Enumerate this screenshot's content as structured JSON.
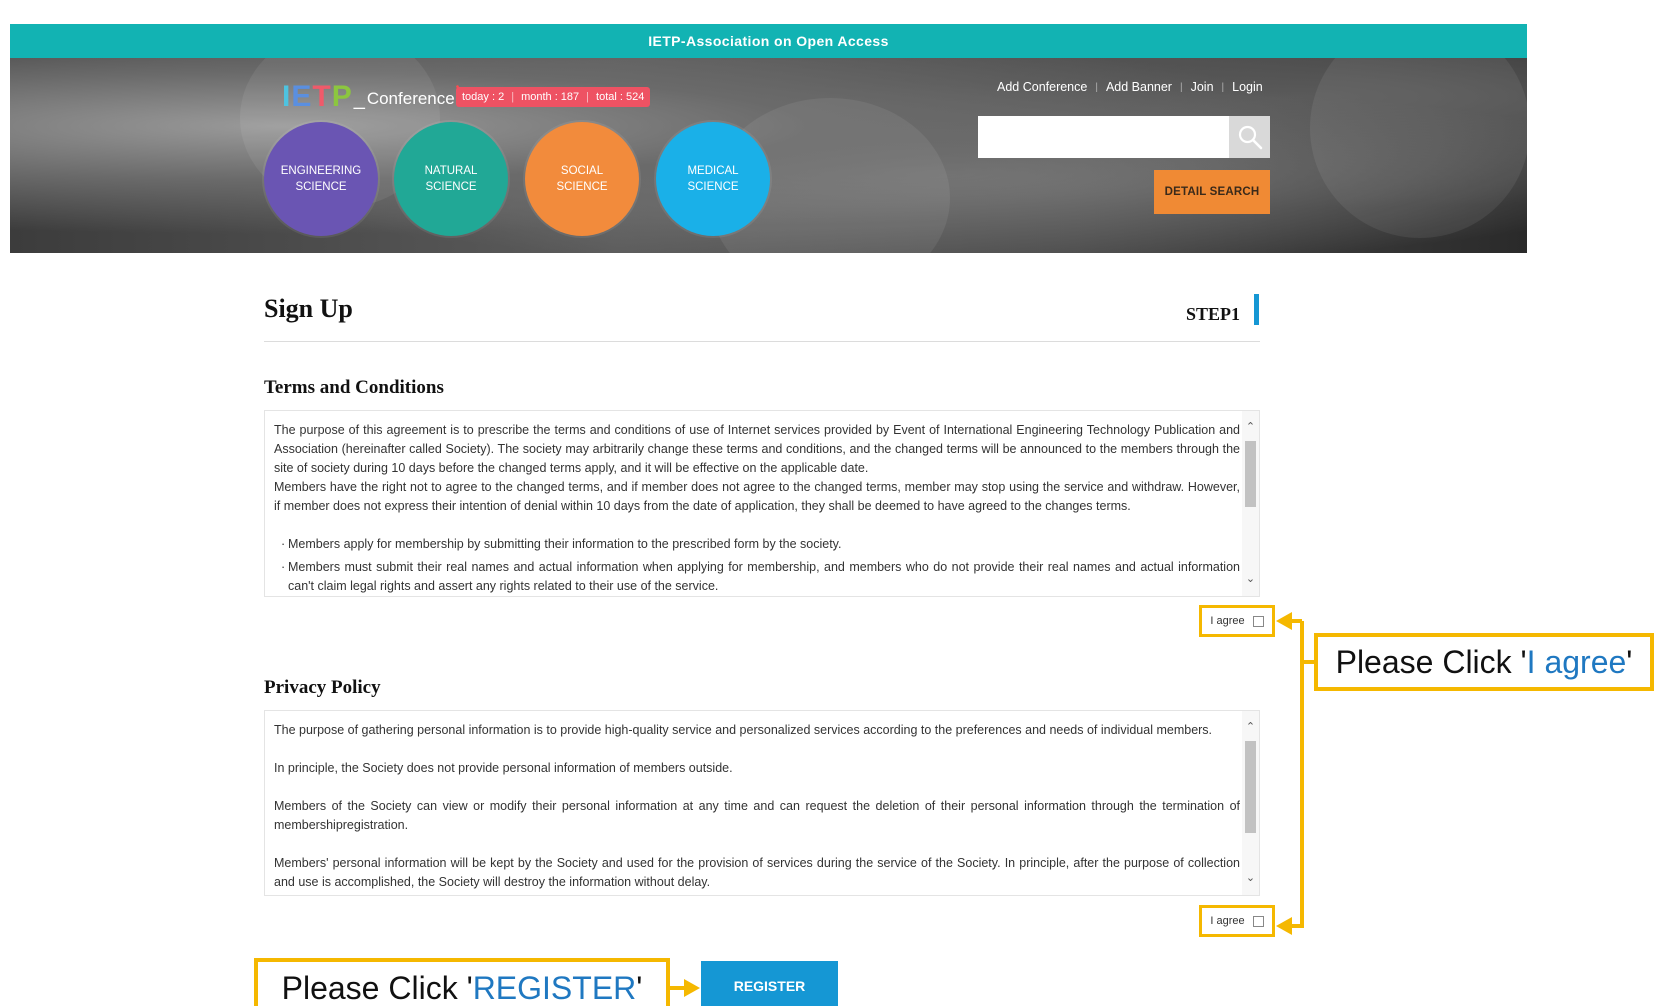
{
  "top_strip": {
    "title": "IETP-Association on Open Access"
  },
  "header": {
    "logo": {
      "letters": [
        "I",
        "E",
        "T",
        "P"
      ],
      "underscore": "_",
      "text": "Conference",
      "dot": "•"
    },
    "stats": {
      "today": "today : 2",
      "month": "month : 187",
      "total": "total : 524"
    },
    "categories": [
      {
        "label": "ENGINEERING\nSCIENCE",
        "color": "#6a55b3"
      },
      {
        "label": "NATURAL\nSCIENCE",
        "color": "#21a896"
      },
      {
        "label": "SOCIAL\nSCIENCE",
        "color": "#f28b3c"
      },
      {
        "label": "MEDICAL\nSCIENCE",
        "color": "#1ab0e8"
      }
    ],
    "links": {
      "add_conference": "Add Conference",
      "add_banner": "Add Banner",
      "join": "Join",
      "login": "Login"
    },
    "search": {
      "placeholder": "",
      "icon": "search-icon"
    },
    "detail_search": "DETAIL SEARCH"
  },
  "page": {
    "title": "Sign Up",
    "step": "STEP1"
  },
  "terms": {
    "title": "Terms and Conditions",
    "para1": "The purpose of this agreement is to prescribe the terms and conditions of use of Internet services provided by Event of International Engineering Technology Publication and Association (hereinafter called Society). The society may arbitrarily change these terms and conditions, and the changed terms will be announced to the members through the site of society during 10 days before the changed terms apply, and it will be effective on the applicable date.",
    "para2": "Members have the right not to agree to the changed terms, and if member does not agree to the changed terms, member may stop using the service and withdraw. However, if member does not express their intention of denial within 10 days from the date of application, they shall be deemed to have agreed to the changes terms.",
    "bullet1": "Members apply for membership by submitting their information to the prescribed form by the society.",
    "bullet2": "Members must submit their real names and actual information when applying for membership, and members who do not provide their real names and actual information can't claim legal rights and assert any rights related to their use of the service.",
    "agree_label": "I agree"
  },
  "privacy": {
    "title": "Privacy Policy",
    "para1": "The purpose of gathering personal information is to provide high-quality service and personalized services according to the preferences and needs of individual members.",
    "para2": "In principle, the Society does not provide personal information of members outside.",
    "para3": "Members of the Society can view or modify their personal information at any time and can request the deletion of their personal information through the termination of membershipregistration.",
    "para4": "Members' personal information will be kept by the Society and used for the provision of services during the service of the Society. In principle, after the purpose of collection and use is accomplished, the Society will destroy the information without delay.",
    "agree_label": "I agree"
  },
  "annotations": {
    "agree": {
      "prefix": "Please Click '",
      "highlight": "I agree",
      "suffix": "'"
    },
    "register": {
      "prefix": "Please Click '",
      "highlight": "REGISTER",
      "suffix": "'"
    }
  },
  "register_label": "REGISTER",
  "colors": {
    "accent": "#12b3b3",
    "annotation": "#f5b800",
    "annotation_text": "#1f78c1",
    "button": "#1597d4",
    "stats": "#ee5263",
    "detail_search": "#f08a34",
    "logo_letters": [
      "#4ec3e0",
      "#5a8fe0",
      "#f05a6a",
      "#8cc63f"
    ]
  }
}
